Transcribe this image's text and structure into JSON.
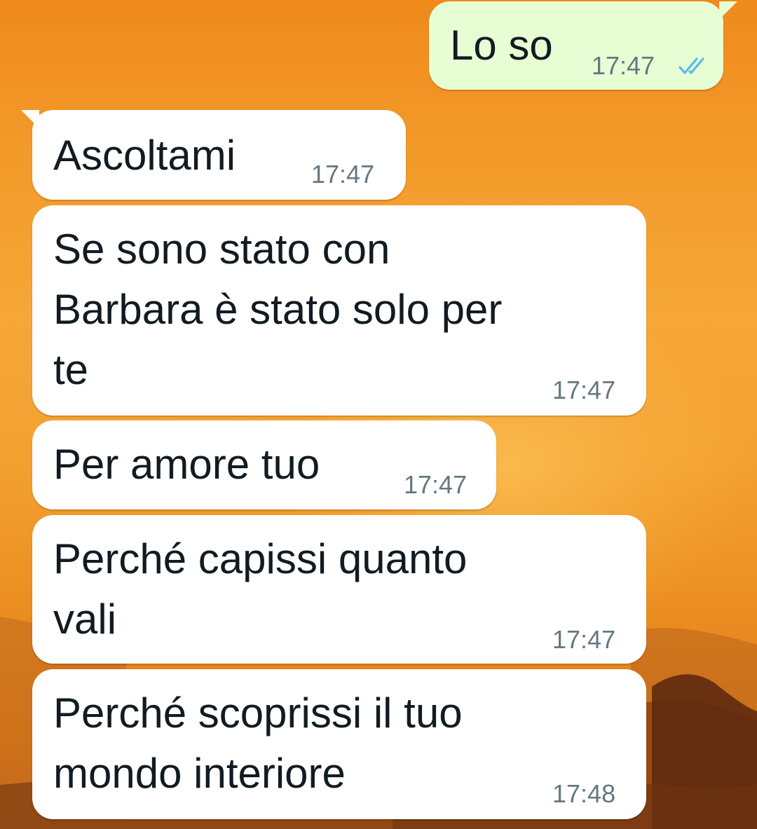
{
  "chat": {
    "messages": [
      {
        "direction": "outgoing",
        "text": "Lo so",
        "time": "17:47",
        "status_icon": "double-check-read-icon"
      },
      {
        "direction": "incoming",
        "text": "Ascoltami",
        "time": "17:47"
      },
      {
        "direction": "incoming",
        "text": "Se sono stato con\nBarbara è stato solo per\nte",
        "time": "17:47"
      },
      {
        "direction": "incoming",
        "text": "Per amore tuo",
        "time": "17:47"
      },
      {
        "direction": "incoming",
        "text": "Perché capissi quanto\nvali",
        "time": "17:47"
      },
      {
        "direction": "incoming",
        "text": "Perché scoprissi il tuo\nmondo interiore",
        "time": "17:48"
      }
    ]
  },
  "colors": {
    "incoming_bubble": "#ffffff",
    "outgoing_bubble": "#e7fed5",
    "read_ticks": "#53bdeb",
    "timestamp": "#667781",
    "wallpaper": "#f29a2a"
  },
  "wallpaper": {
    "theme": "sunset-mountains"
  }
}
